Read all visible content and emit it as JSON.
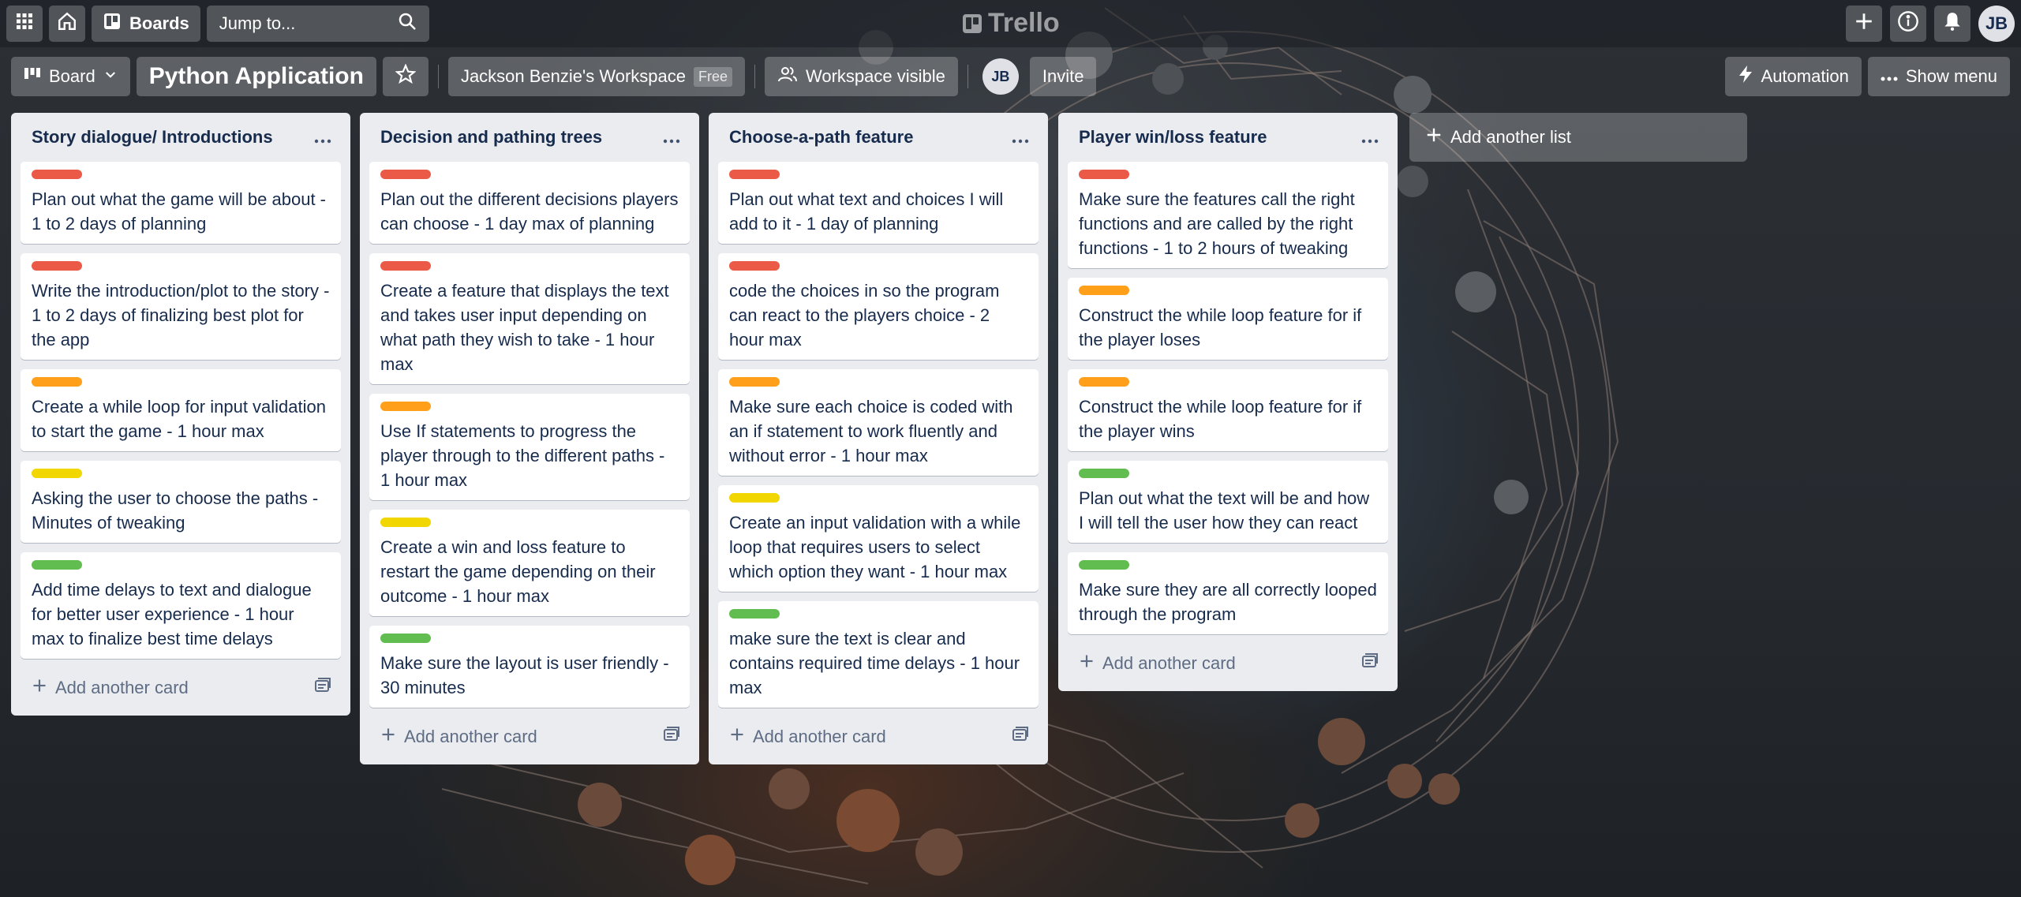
{
  "header": {
    "boards_label": "Boards",
    "search_placeholder": "Jump to...",
    "logo_text": "Trello",
    "avatar_initials": "JB"
  },
  "board": {
    "view_label": "Board",
    "title": "Python Application",
    "workspace_name": "Jackson Benzie's Workspace",
    "workspace_badge": "Free",
    "visibility_label": "Workspace visible",
    "member_initials": "JB",
    "invite_label": "Invite",
    "automation_label": "Automation",
    "show_menu_label": "Show menu"
  },
  "colors": {
    "red": "#eb5a46",
    "orange": "#ff9f1a",
    "yellow": "#f2d600",
    "green": "#61bd4f"
  },
  "add_card_label": "Add another card",
  "add_list_label": "Add another list",
  "lists": [
    {
      "title": "Story dialogue/ Introductions",
      "cards": [
        {
          "label": "red",
          "text": "Plan out what the game will be about - 1 to 2 days of planning"
        },
        {
          "label": "red",
          "text": "Write the introduction/plot to the story - 1 to 2 days of finalizing best plot for the app"
        },
        {
          "label": "orange",
          "text": "Create a while loop for input validation to start the game - 1 hour max"
        },
        {
          "label": "yellow",
          "text": "Asking the user to choose the paths - Minutes of tweaking"
        },
        {
          "label": "green",
          "text": "Add time delays to text and dialogue for better user experience - 1 hour max to finalize best time delays"
        }
      ]
    },
    {
      "title": "Decision and pathing trees",
      "cards": [
        {
          "label": "red",
          "text": "Plan out the different decisions players can choose - 1 day max of planning"
        },
        {
          "label": "red",
          "text": "Create a feature that displays the text and takes user input depending on what path they wish to take - 1 hour max"
        },
        {
          "label": "orange",
          "text": "Use If statements to progress the player through to the different paths - 1 hour max"
        },
        {
          "label": "yellow",
          "text": "Create a win and loss feature to restart the game depending on their outcome - 1 hour max"
        },
        {
          "label": "green",
          "text": "Make sure the layout is user friendly - 30 minutes"
        }
      ]
    },
    {
      "title": "Choose-a-path feature",
      "cards": [
        {
          "label": "red",
          "text": "Plan out what text and choices I will add to it - 1 day of planning"
        },
        {
          "label": "red",
          "text": "code the choices in so the program can react to the players choice - 2 hour max"
        },
        {
          "label": "orange",
          "text": "Make sure each choice is coded with an if statement to work fluently and without error - 1 hour max"
        },
        {
          "label": "yellow",
          "text": "Create an input validation with a while loop that requires users to select which option they want - 1 hour max"
        },
        {
          "label": "green",
          "text": "make sure the text is clear and contains required time delays - 1 hour max"
        }
      ]
    },
    {
      "title": "Player win/loss feature",
      "cards": [
        {
          "label": "red",
          "text": "Make sure the features call the right functions and are called by the right functions - 1 to 2 hours of tweaking"
        },
        {
          "label": "orange",
          "text": "Construct the while loop feature for if the player loses"
        },
        {
          "label": "orange",
          "text": "Construct the while loop feature for if the player wins"
        },
        {
          "label": "green",
          "text": "Plan out what the text will be and how I will tell the user how they can react"
        },
        {
          "label": "green",
          "text": "Make sure they are all correctly looped through the program"
        }
      ]
    }
  ]
}
